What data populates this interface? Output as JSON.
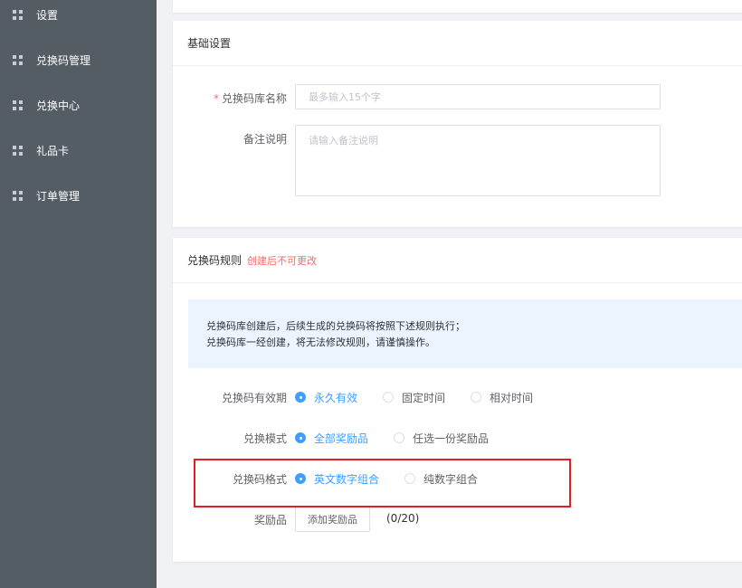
{
  "sidebar": {
    "items": [
      {
        "label": "设置",
        "icon": "grid-icon"
      },
      {
        "label": "兑换码管理",
        "icon": "grid-icon"
      },
      {
        "label": "兑换中心",
        "icon": "grid-icon"
      },
      {
        "label": "礼品卡",
        "icon": "grid-icon"
      },
      {
        "label": "订单管理",
        "icon": "grid-icon"
      }
    ]
  },
  "basic": {
    "title": "基础设置",
    "name_label": "兑换码库名称",
    "name_required": "*",
    "name_placeholder": "最多输入15个字",
    "remark_label": "备注说明",
    "remark_placeholder": "请输入备注说明"
  },
  "rules": {
    "title": "兑换码规则",
    "hint": "创建后不可更改",
    "notice_line1": "兑换码库创建后，后续生成的兑换码将按照下述规则执行；",
    "notice_line2": "兑换码库一经创建，将无法修改规则，请谨慎操作。",
    "validity": {
      "label": "兑换码有效期",
      "options": [
        "永久有效",
        "固定时间",
        "相对时间"
      ],
      "selected": "永久有效"
    },
    "mode": {
      "label": "兑换模式",
      "options": [
        "全部奖励品",
        "任选一份奖励品"
      ],
      "selected": "全部奖励品"
    },
    "format": {
      "label": "兑换码格式",
      "options": [
        "英文数字组合",
        "纯数字组合"
      ],
      "selected": "英文数字组合"
    },
    "rewards": {
      "label": "奖励品",
      "button": "添加奖励品",
      "count": "(0/20)"
    }
  },
  "colors": {
    "sidebar_bg": "#545c64",
    "accent": "#409eff",
    "danger": "#f56c6c",
    "highlight_border": "#e02020",
    "notice_bg": "#ecf5ff"
  }
}
